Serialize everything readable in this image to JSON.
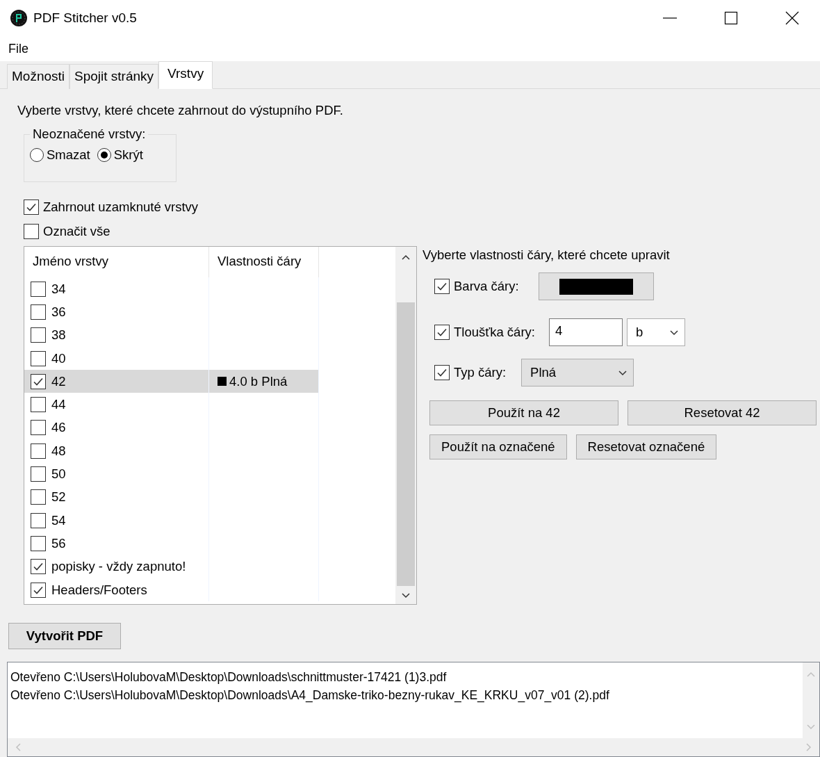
{
  "window": {
    "title": "PDF Stitcher v0.5"
  },
  "menu": [
    "File"
  ],
  "tabs": [
    {
      "label": "Možnosti",
      "selected": false
    },
    {
      "label": "Spojit stránky",
      "selected": false
    },
    {
      "label": "Vrstvy",
      "selected": true
    }
  ],
  "description": "Vyberte vrstvy, které chcete zahrnout do výstupního PDF.",
  "unmarked_layers": {
    "title": "Neoznačené vrstvy:",
    "options": [
      {
        "label": "Smazat",
        "selected": false
      },
      {
        "label": "Skrýt",
        "selected": true
      }
    ]
  },
  "options": [
    {
      "label": "Zahrnout uzamknuté vrstvy",
      "checked": true
    },
    {
      "label": "Označit vše",
      "checked": false
    }
  ],
  "layer_table": {
    "columns": [
      "Jméno vrstvy",
      "Vlastnosti čáry"
    ],
    "rows": [
      {
        "name": "34",
        "checked": false,
        "selected": false
      },
      {
        "name": "36",
        "checked": false,
        "selected": false
      },
      {
        "name": "38",
        "checked": false,
        "selected": false
      },
      {
        "name": "40",
        "checked": false,
        "selected": false
      },
      {
        "name": "42",
        "checked": true,
        "selected": true,
        "properties": "4.0 b Plná",
        "color": "#000000"
      },
      {
        "name": "44",
        "checked": false,
        "selected": false
      },
      {
        "name": "46",
        "checked": false,
        "selected": false
      },
      {
        "name": "48",
        "checked": false,
        "selected": false
      },
      {
        "name": "50",
        "checked": false,
        "selected": false
      },
      {
        "name": "52",
        "checked": false,
        "selected": false
      },
      {
        "name": "54",
        "checked": false,
        "selected": false
      },
      {
        "name": "56",
        "checked": false,
        "selected": false
      },
      {
        "name": "popisky - vždy zapnuto!",
        "checked": true,
        "selected": false
      },
      {
        "name": "Headers/Footers",
        "checked": true,
        "selected": false
      }
    ]
  },
  "line_properties": {
    "title": "Vyberte vlastnosti čáry, které chcete upravit",
    "color": {
      "label": "Barva čáry:",
      "checked": true,
      "color": "#000000"
    },
    "thickness": {
      "label": "Tloušťka čáry:",
      "checked": true,
      "value": "4",
      "unit": "b"
    },
    "type": {
      "label": "Typ čáry:",
      "checked": true,
      "value": "Plná"
    },
    "buttons": [
      [
        "Použít na 42",
        "Resetovat 42"
      ],
      [
        "Použít na označené",
        "Resetovat označené"
      ]
    ]
  },
  "create_button": "Vytvořit PDF",
  "log": [
    "Otevřeno C:\\Users\\HolubovaM\\Desktop\\Downloads\\schnittmuster-17421 (1)3.pdf",
    "Otevřeno C:\\Users\\HolubovaM\\Desktop\\Downloads\\A4_Damske-triko-bezny-rukav_KE_KRKU_v07_v01 (2).pdf"
  ]
}
